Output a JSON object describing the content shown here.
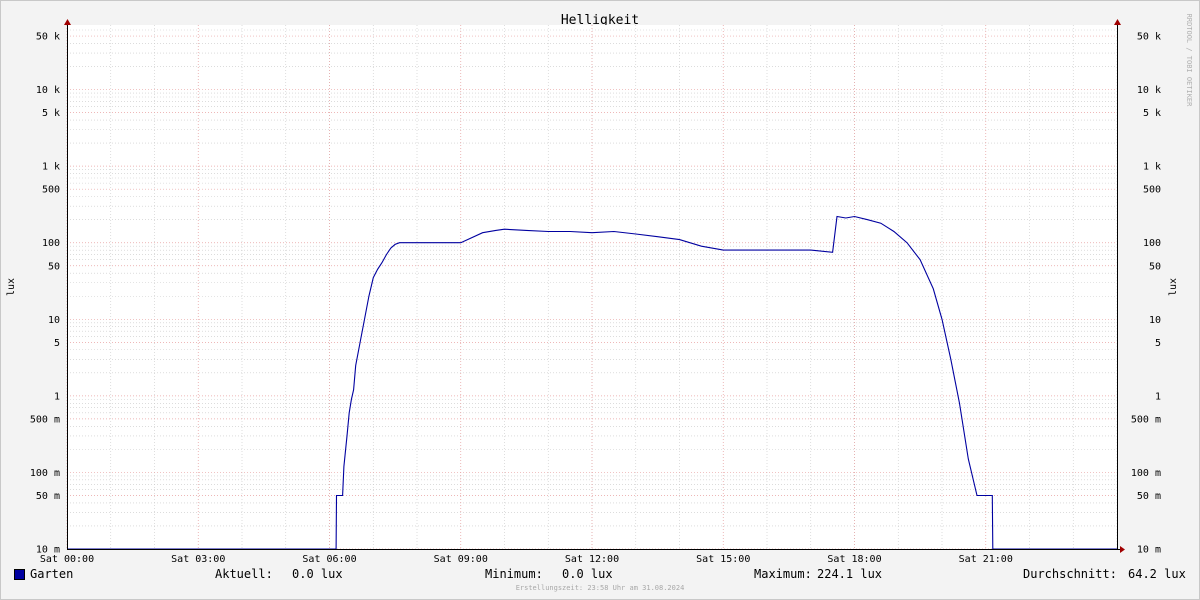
{
  "colors": {
    "background": "#f3f3f3",
    "plot_background": "#ffffff",
    "line": "#0000a0",
    "major_grid": "#e8a0a0",
    "minor_grid": "#c8c8c8",
    "axis_arrow": "#a00000"
  },
  "chart": {
    "title": "Helligkeit",
    "ylabel": "lux",
    "watermark": "RRDTOOL / TOBI OETIKER",
    "footer": "Erstellungszeit: 23:58 Uhr am 31.08.2024"
  },
  "legend": {
    "series_name": "Garten",
    "current_label": "Aktuell:",
    "current_value": "0.0 lux",
    "min_label": "Minimum:",
    "min_value": "0.0 lux",
    "max_label": "Maximum:",
    "max_value": "224.1 lux",
    "avg_label": "Durchschnitt:",
    "avg_value": "64.2 lux"
  },
  "chart_data": {
    "type": "line",
    "title": "Helligkeit",
    "ylabel": "lux",
    "yscale": "log",
    "xlim_hours": [
      0,
      24
    ],
    "ylim": [
      10,
      80000
    ],
    "grid": true,
    "legend_position": "bottom-left",
    "x_ticks": [
      {
        "h": 0,
        "label": "Sat 00:00"
      },
      {
        "h": 3,
        "label": "Sat 03:00"
      },
      {
        "h": 6,
        "label": "Sat 06:00"
      },
      {
        "h": 9,
        "label": "Sat 09:00"
      },
      {
        "h": 12,
        "label": "Sat 12:00"
      },
      {
        "h": 15,
        "label": "Sat 15:00"
      },
      {
        "h": 18,
        "label": "Sat 18:00"
      },
      {
        "h": 21,
        "label": "Sat 21:00"
      }
    ],
    "y_ticks": [
      {
        "v": 0.01,
        "label": "10 m"
      },
      {
        "v": 0.05,
        "label": "50 m"
      },
      {
        "v": 0.1,
        "label": "100 m"
      },
      {
        "v": 0.5,
        "label": "500 m"
      },
      {
        "v": 1,
        "label": "1"
      },
      {
        "v": 5,
        "label": "5"
      },
      {
        "v": 10,
        "label": "10"
      },
      {
        "v": 50,
        "label": "50"
      },
      {
        "v": 100,
        "label": "100"
      },
      {
        "v": 500,
        "label": "500"
      },
      {
        "v": 1000,
        "label": "1 k"
      },
      {
        "v": 5000,
        "label": "5 k"
      },
      {
        "v": 10000,
        "label": "10 k"
      },
      {
        "v": 50000,
        "label": "50 k"
      }
    ],
    "series": [
      {
        "name": "Garten",
        "x_hours": [
          0,
          6.15,
          6.16,
          6.3,
          6.33,
          6.4,
          6.45,
          6.5,
          6.55,
          6.6,
          6.7,
          6.8,
          6.9,
          7.0,
          7.1,
          7.2,
          7.3,
          7.4,
          7.5,
          7.6,
          7.8,
          8.0,
          8.2,
          8.4,
          8.6,
          9.0,
          9.5,
          9.8,
          10.0,
          10.5,
          11.0,
          11.5,
          12.0,
          12.5,
          13.0,
          13.5,
          14.0,
          14.5,
          15.0,
          15.3,
          15.7,
          16.0,
          16.5,
          17.0,
          17.5,
          17.6,
          17.8,
          18.0,
          18.3,
          18.6,
          18.9,
          19.2,
          19.5,
          19.8,
          20.0,
          20.2,
          20.4,
          20.6,
          20.8,
          20.9,
          21.0,
          21.1,
          21.15,
          21.16,
          21.2,
          24
        ],
        "y": [
          0.01,
          0.01,
          0.05,
          0.05,
          0.12,
          0.3,
          0.6,
          0.9,
          1.2,
          2.5,
          5,
          10,
          20,
          35,
          45,
          55,
          70,
          85,
          95,
          100,
          100,
          100,
          100,
          100,
          100,
          100,
          135,
          145,
          150,
          145,
          140,
          140,
          135,
          140,
          130,
          120,
          110,
          90,
          80,
          80,
          80,
          80,
          80,
          80,
          75,
          220,
          210,
          220,
          200,
          180,
          140,
          100,
          60,
          25,
          10,
          3,
          0.8,
          0.15,
          0.05,
          0.05,
          0.05,
          0.05,
          0.05,
          0.01,
          0.01,
          0.01
        ]
      }
    ]
  }
}
